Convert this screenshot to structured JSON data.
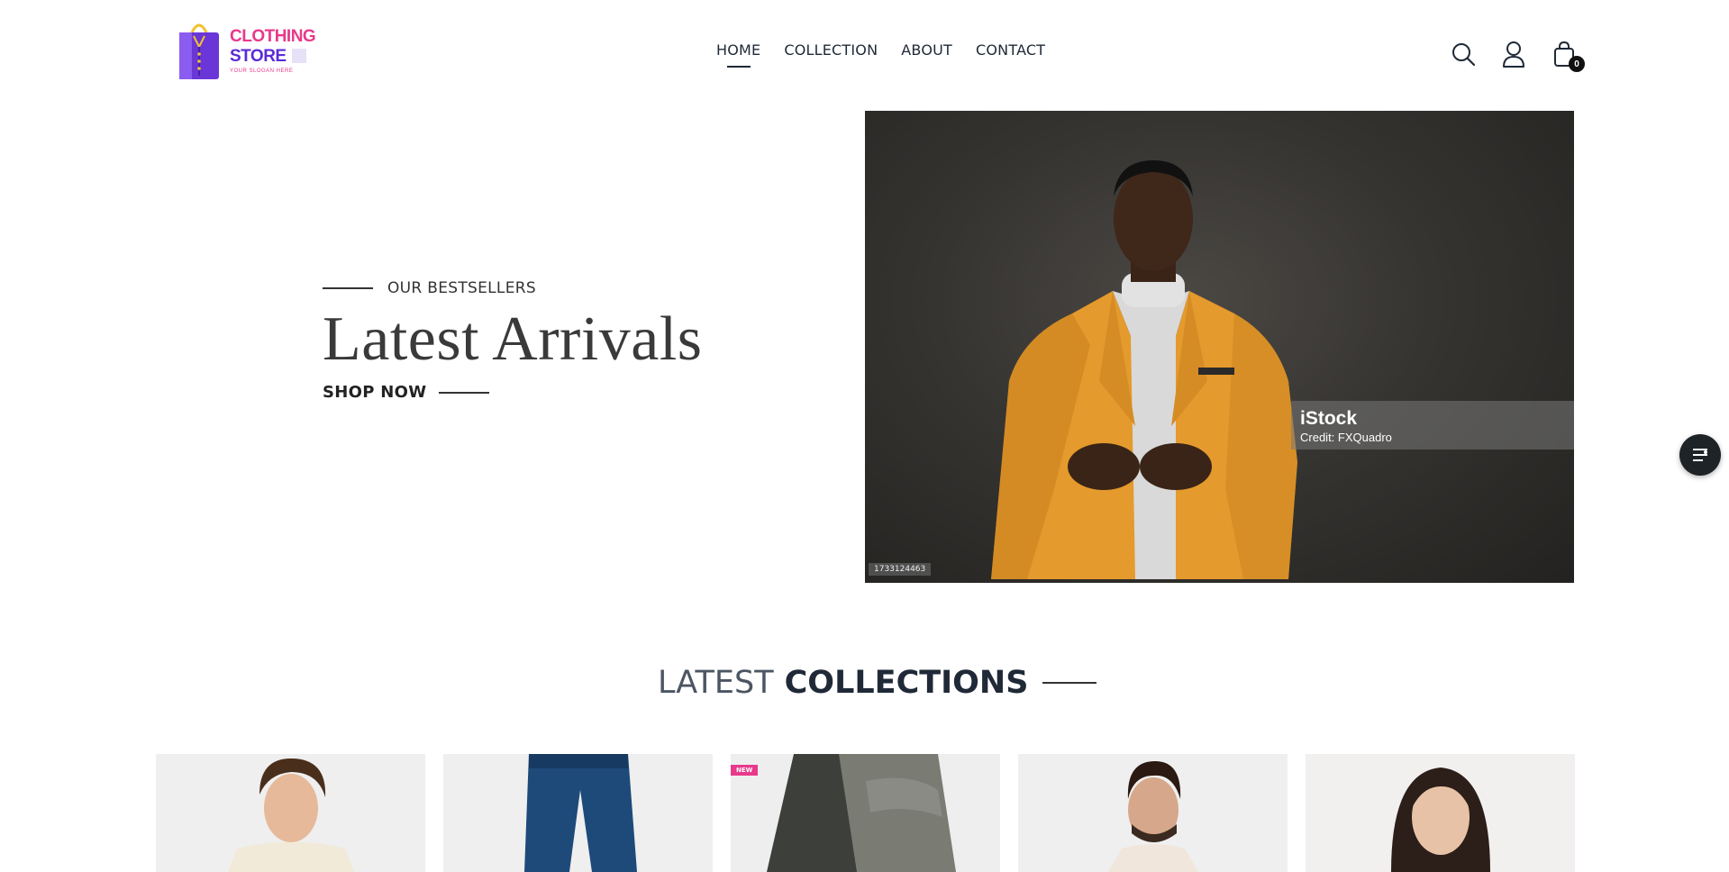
{
  "logo": {
    "line1": "CLOTHING",
    "line2": "STORE",
    "slogan": "YOUR SLOGAN HERE"
  },
  "nav": {
    "items": [
      {
        "label": "HOME",
        "active": true
      },
      {
        "label": "COLLECTION",
        "active": false
      },
      {
        "label": "ABOUT",
        "active": false
      },
      {
        "label": "CONTACT",
        "active": false
      }
    ]
  },
  "header_icons": {
    "search": "search-icon",
    "account": "user-icon",
    "cart": "shopping-bag-icon",
    "cart_count": "0"
  },
  "hero": {
    "eyebrow": "OUR BESTSELLERS",
    "title": "Latest Arrivals",
    "cta": "SHOP NOW",
    "image": {
      "watermark_brand": "iStock",
      "watermark_credit": "Credit: FXQuadro",
      "image_id": "1733124463"
    }
  },
  "collections": {
    "title_light": "LATEST",
    "title_bold": "COLLECTIONS",
    "products": [
      {
        "badge": ""
      },
      {
        "badge": ""
      },
      {
        "badge": "NEW"
      },
      {
        "badge": ""
      },
      {
        "badge": ""
      }
    ]
  },
  "colors": {
    "brand_pink": "#e8398b",
    "brand_purple": "#5b2bd6",
    "text_dark": "#1f2937",
    "jacket_orange": "#e8a030"
  }
}
